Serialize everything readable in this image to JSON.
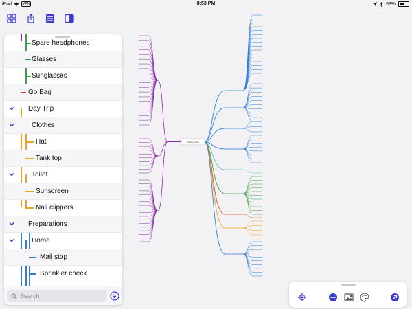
{
  "status_bar": {
    "device": "iPad",
    "vpn": "VPN",
    "time": "8:53 PM",
    "battery": "53%",
    "battery_level": 0.53
  },
  "toolbar": {
    "icons": [
      "grid-icon",
      "share-icon",
      "outline-view-icon",
      "sidebar-toggle-icon"
    ]
  },
  "outline": {
    "rows": [
      {
        "label": "Spare headphones",
        "collapsible": false
      },
      {
        "label": "Glasses",
        "collapsible": false
      },
      {
        "label": "Sunglasses",
        "collapsible": false
      },
      {
        "label": "Go Bag",
        "collapsible": false
      },
      {
        "label": "Day Trip",
        "collapsible": true
      },
      {
        "label": "Clothes",
        "collapsible": true
      },
      {
        "label": "Hat",
        "collapsible": false
      },
      {
        "label": "Tank top",
        "collapsible": false
      },
      {
        "label": "Toilet",
        "collapsible": true
      },
      {
        "label": "Sunscreen",
        "collapsible": false
      },
      {
        "label": "Nail clippers",
        "collapsible": false
      },
      {
        "label": "Preparations",
        "collapsible": true
      },
      {
        "label": "Home",
        "collapsible": true
      },
      {
        "label": "Mail stop",
        "collapsible": false
      },
      {
        "label": "Sprinkler check",
        "collapsible": false
      }
    ],
    "search_placeholder": "Search"
  },
  "mindmap": {
    "center": "Packing Lists",
    "branches": [
      {
        "label": "Long Weekend",
        "color": "#2f7fd6"
      },
      {
        "label": "Go Bag",
        "color": "#5fc8c8"
      },
      {
        "label": "Vacation",
        "color": "#3aa040"
      },
      {
        "label": "Go Bag",
        "color": "#e04a2a"
      },
      {
        "label": "Day Trip",
        "color": "#f0a020"
      },
      {
        "label": "Preparations",
        "color": "#2f7fd6"
      },
      {
        "label": "Enter Trip",
        "color": "#8a2aa8"
      }
    ],
    "left_groups": [
      "Clothes",
      "Electronics",
      "Tech",
      "Toilet"
    ],
    "right_groups": [
      "Electronics",
      "Tech",
      "Clothing",
      "Toilet",
      "Home",
      "Destination"
    ]
  },
  "colors": {
    "accent": "#3a3ad0",
    "purple": "#8a2aa8",
    "blue": "#2f7fd6",
    "green": "#3aa040",
    "orange": "#f0a020",
    "teal": "#5fc8c8",
    "red": "#e04a2a"
  }
}
